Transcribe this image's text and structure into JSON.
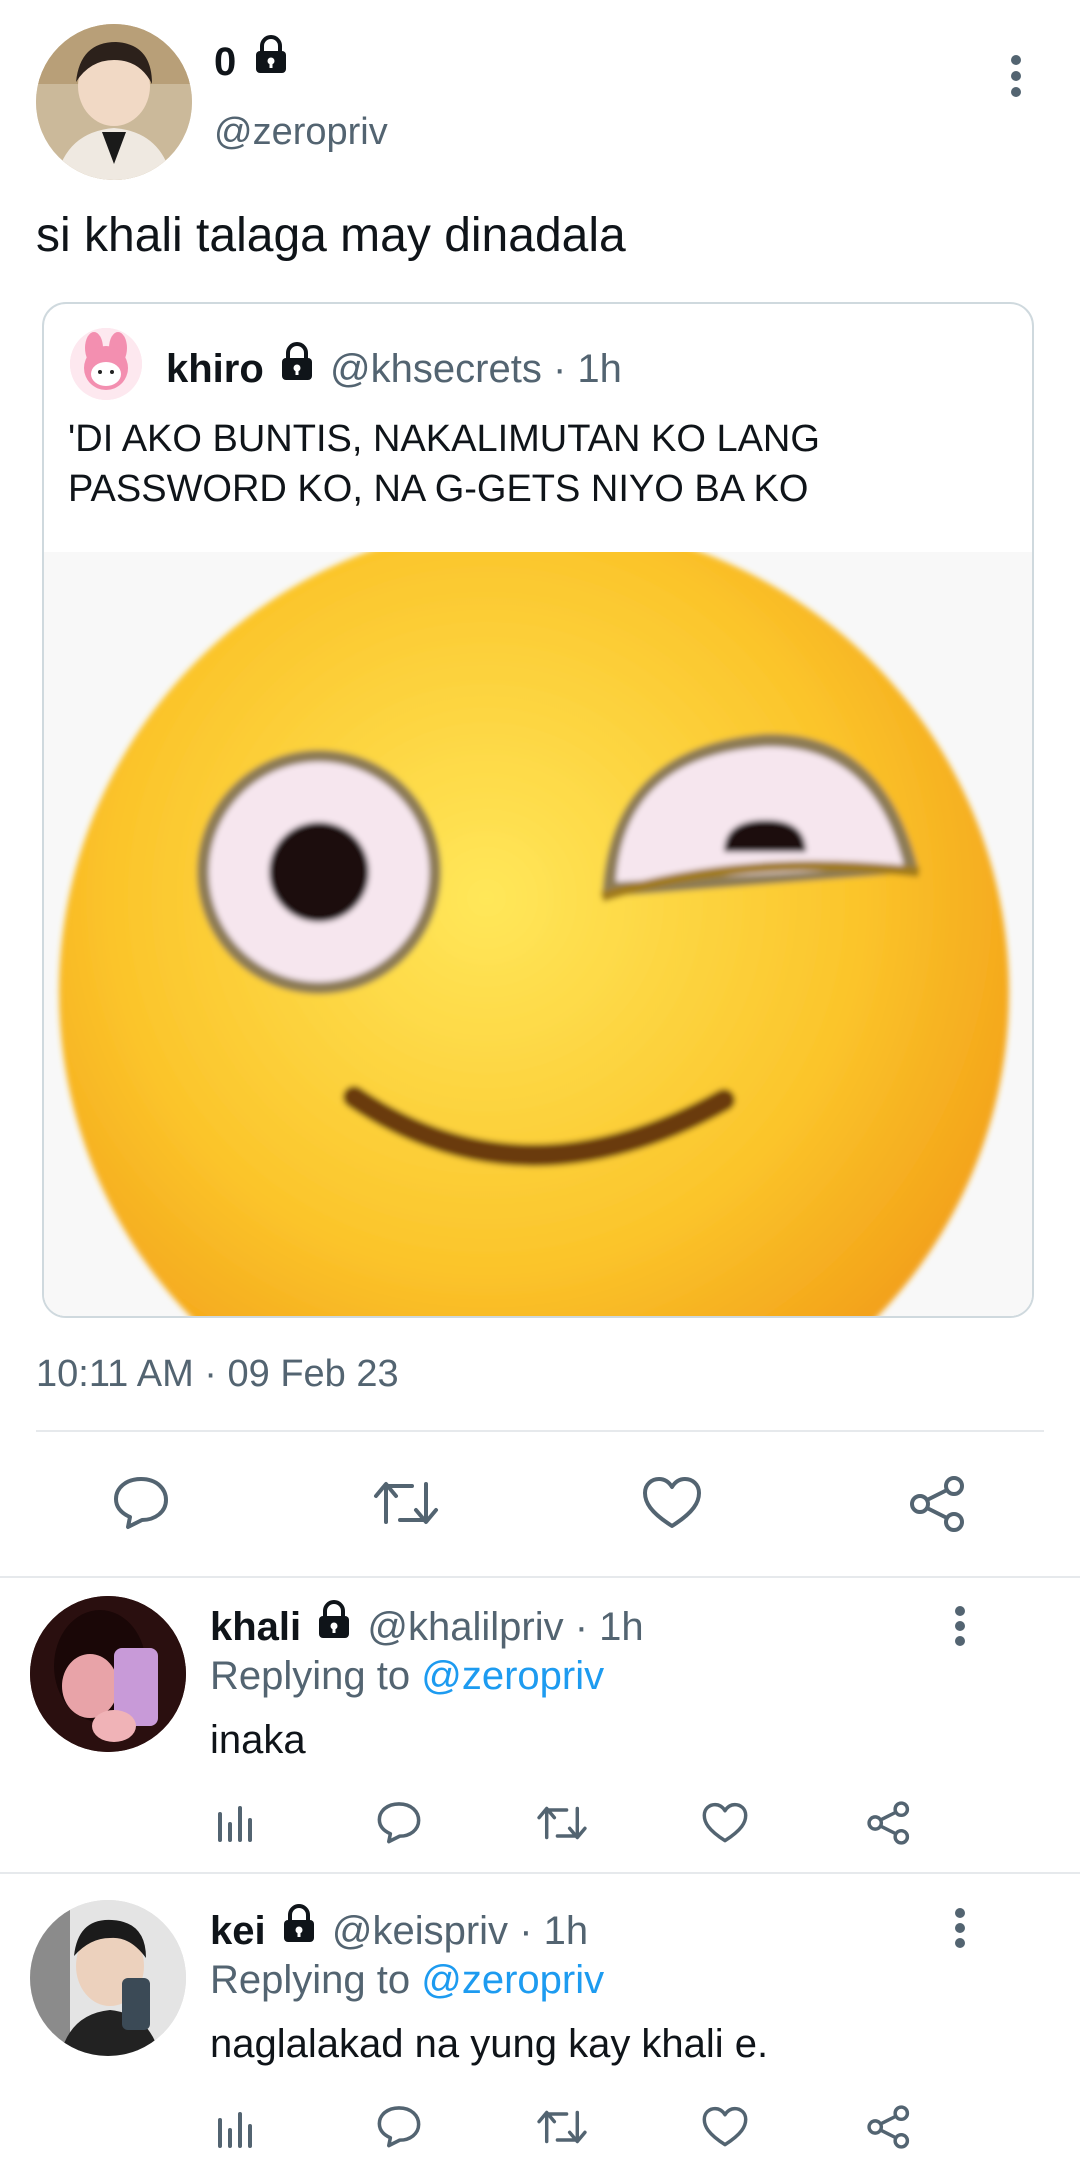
{
  "main_tweet": {
    "display_name": "0",
    "handle": "@zeropriv",
    "text": "si khali talaga may dinadala",
    "timestamp": "10:11 AM · 09 Feb 23"
  },
  "quoted_tweet": {
    "display_name": "khiro",
    "handle": "@khsecrets",
    "time": "· 1h",
    "text": "'DI AKO BUNTIS, NAKALIMUTAN KO LANG PASSWORD KO, NA G-GETS NIYO BA KO"
  },
  "actions": {
    "icons": [
      "reply-icon",
      "retweet-icon",
      "like-icon",
      "share-icon"
    ]
  },
  "replies": [
    {
      "display_name": "khali",
      "handle": "@khalilpriv",
      "time": "· 1h",
      "replying_prefix": "Replying to",
      "replying_handle": "@zeropriv",
      "text": "inaka"
    },
    {
      "display_name": "kei",
      "handle": "@keispriv",
      "time": "· 1h",
      "replying_prefix": "Replying to",
      "replying_handle": "@zeropriv",
      "text": "naglalakad na yung kay khali e."
    }
  ],
  "colors": {
    "link": "#1d9bf0",
    "secondary_text": "#536471",
    "divider": "#e6e9ec"
  }
}
